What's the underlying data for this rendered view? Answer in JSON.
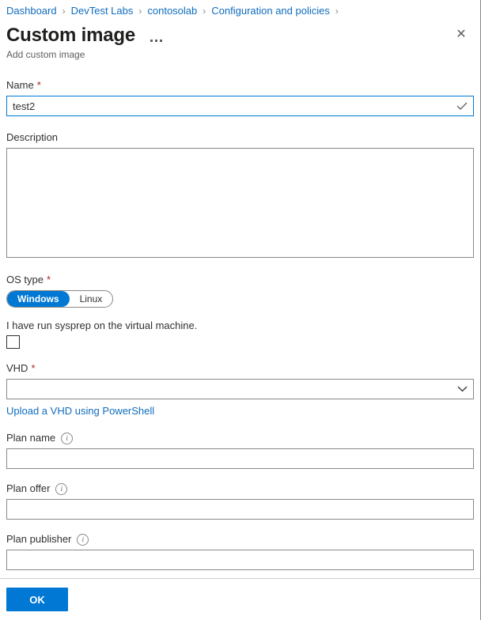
{
  "breadcrumb": {
    "separator": "›",
    "items": [
      {
        "label": "Dashboard"
      },
      {
        "label": "DevTest Labs"
      },
      {
        "label": "contosolab"
      },
      {
        "label": "Configuration and policies"
      }
    ]
  },
  "header": {
    "title": "Custom image",
    "subtitle": "Add custom image",
    "more_icon": "ellipsis-icon",
    "close_icon": "close-icon",
    "close_label": "✕"
  },
  "form": {
    "name": {
      "label": "Name",
      "required_marker": "*",
      "value": "test2",
      "placeholder": "",
      "valid_icon": "checkmark-icon"
    },
    "description": {
      "label": "Description",
      "value": "",
      "placeholder": ""
    },
    "os_type": {
      "label": "OS type",
      "required_marker": "*",
      "options": [
        {
          "label": "Windows",
          "selected": true
        },
        {
          "label": "Linux",
          "selected": false
        }
      ],
      "selected": "Windows"
    },
    "sysprep": {
      "label": "I have run sysprep on the virtual machine.",
      "checked": false
    },
    "vhd": {
      "label": "VHD",
      "required_marker": "*",
      "value": "",
      "chevron_icon": "chevron-down-icon",
      "upload_link": "Upload a VHD using PowerShell"
    },
    "plan_name": {
      "label": "Plan name",
      "info_icon": "info-icon",
      "info_glyph": "i",
      "value": "",
      "placeholder": ""
    },
    "plan_offer": {
      "label": "Plan offer",
      "info_icon": "info-icon",
      "info_glyph": "i",
      "value": "",
      "placeholder": ""
    },
    "plan_publisher": {
      "label": "Plan publisher",
      "info_icon": "info-icon",
      "info_glyph": "i",
      "value": "",
      "placeholder": ""
    }
  },
  "footer": {
    "ok_label": "OK"
  },
  "colors": {
    "accent": "#0078d4",
    "link": "#0f6cbd",
    "required": "#a4262c",
    "border": "#8a8886",
    "text": "#323130",
    "subtle_text": "#605e5c"
  }
}
